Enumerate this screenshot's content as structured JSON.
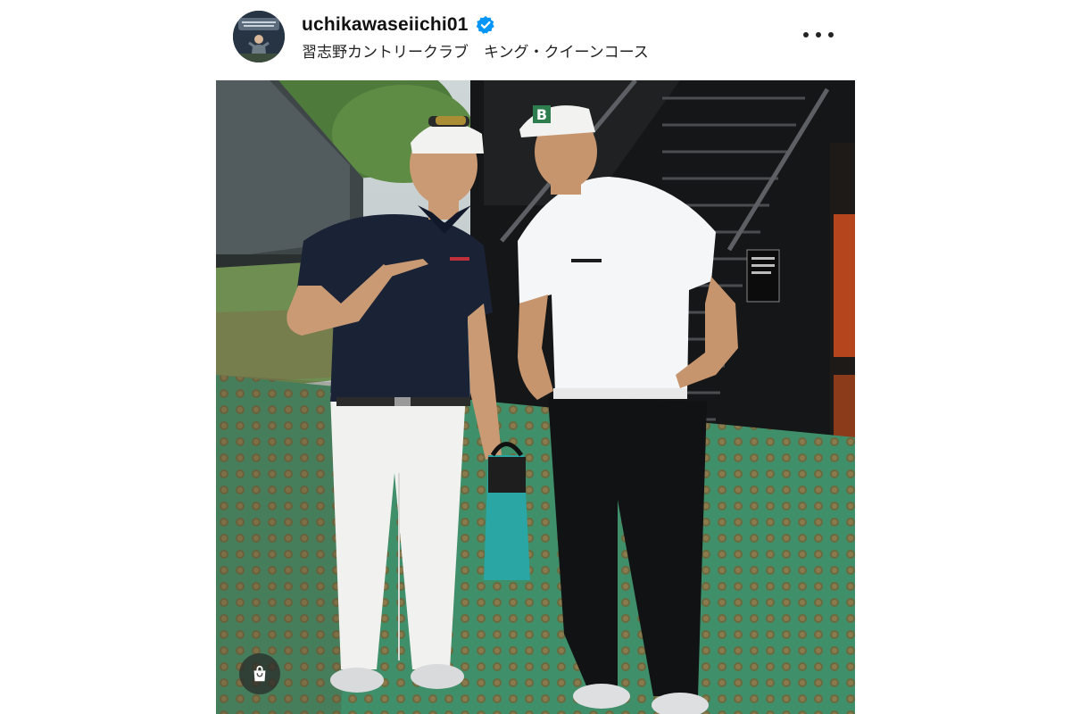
{
  "post": {
    "username": "uchikawaseiichi01",
    "location": "習志野カントリークラブ　キング・クイーンコース",
    "verified": true,
    "more_icon": "more-horizontal-icon",
    "shop_icon": "shopping-bag-icon"
  },
  "colors": {
    "verified_badge": "#0095f6",
    "turf_mat": "#3f8f6a",
    "stairs": "#1a1a1a"
  }
}
